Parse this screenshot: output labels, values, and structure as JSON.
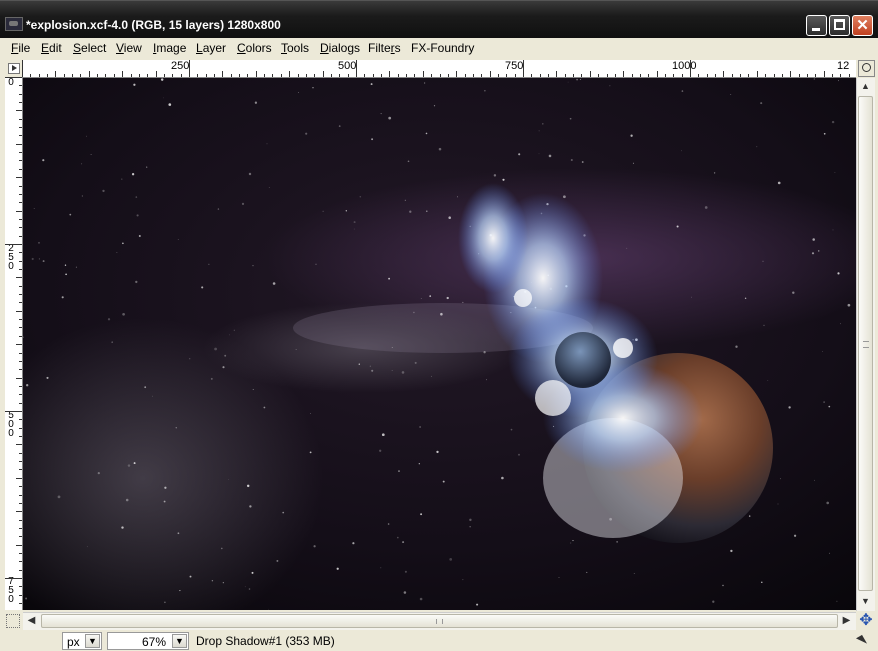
{
  "window": {
    "title": "*explosion.xcf-4.0 (RGB, 15 layers) 1280x800",
    "buttons": {
      "minimize": "minimize",
      "maximize": "maximize",
      "close": "✕"
    }
  },
  "menu": {
    "items": [
      "File",
      "Edit",
      "Select",
      "View",
      "Image",
      "Layer",
      "Colors",
      "Tools",
      "Dialogs",
      "Filters",
      "FX-Foundry"
    ],
    "mnemonics": [
      "F",
      "E",
      "S",
      "V",
      "I",
      "L",
      "C",
      "T",
      "D",
      "r",
      ""
    ]
  },
  "ruler": {
    "top_labels": [
      "250",
      "500",
      "750",
      "1000",
      "12"
    ],
    "left_labels": [
      "0",
      "250",
      "500",
      "750"
    ]
  },
  "status": {
    "unit": "px",
    "zoom": "67%",
    "message": "Drop Shadow#1 (353 MB)"
  },
  "icons": {
    "app": "gimp-image-icon",
    "zoom_toggle": "zoom-icon",
    "quick_mask": "quick-mask-icon",
    "navigate": "navigate-icon",
    "menu_arrow": "ruler-menu-arrow-icon"
  },
  "colors": {
    "titlebar": "#1b1b1b",
    "chrome": "#ece9d8",
    "close": "#c04020",
    "canvas_bg": "#120d16"
  }
}
